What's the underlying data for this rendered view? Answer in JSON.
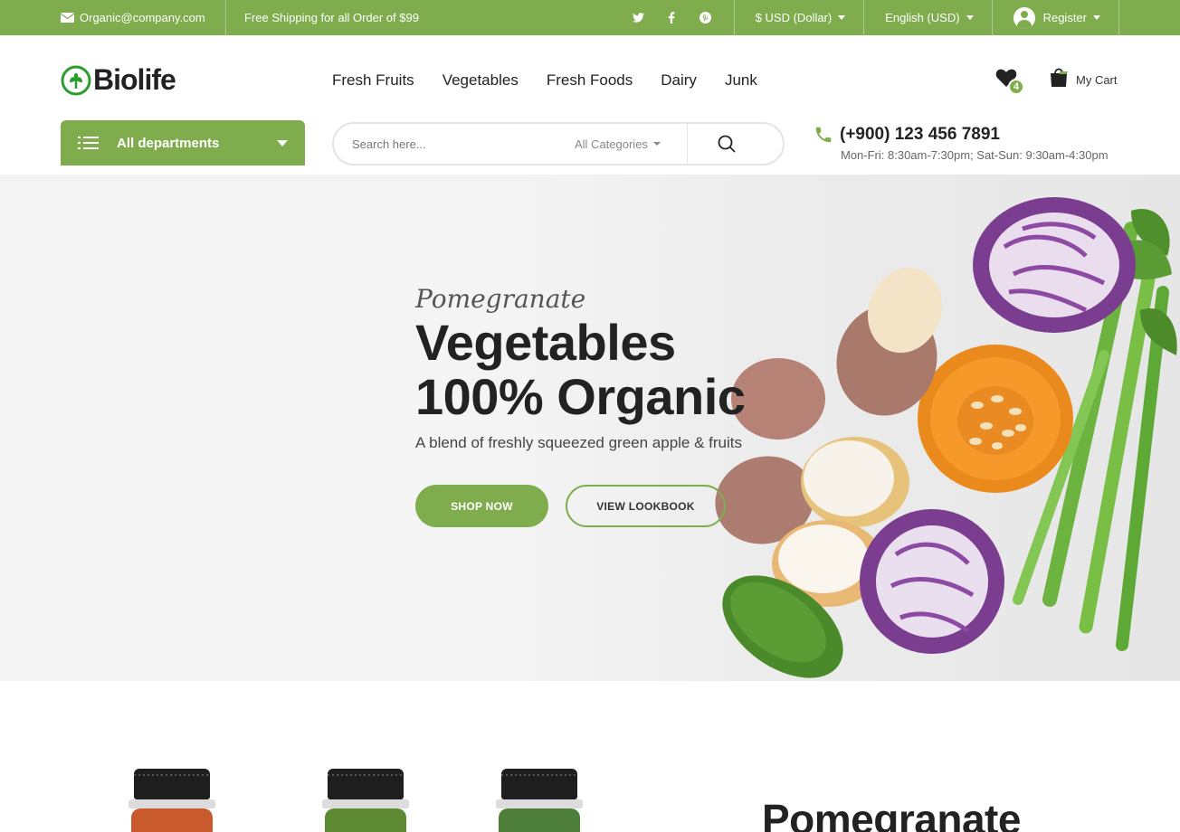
{
  "topbar": {
    "email": "Organic@company.com",
    "shipping": "Free Shipping for all Order of $99",
    "social": [
      "twitter-icon",
      "facebook-icon",
      "pinterest-icon"
    ],
    "currency": "$ USD (Dollar)",
    "language": "English (USD)",
    "register": "Register"
  },
  "header": {
    "logo": "Biolife",
    "nav": [
      "Fresh Fruits",
      "Vegetables",
      "Fresh Foods",
      "Dairy",
      "Junk"
    ],
    "wishlist_count": "4",
    "cart_label": "My Cart"
  },
  "search": {
    "departments_label": "All departments",
    "placeholder": "Search here...",
    "category": "All Categories"
  },
  "contact": {
    "phone": "(+900) 123 456 7891",
    "hours": "Mon-Fri: 8:30am-7:30pm; Sat-Sun: 9:30am-4:30pm"
  },
  "hero": {
    "subtitle": "Pomegranate",
    "title_line1": "Vegetables",
    "title_line2": "100% Organic",
    "description": "A blend of freshly squeezed green apple & fruits",
    "shop_button": "SHOP NOW",
    "lookbook_button": "VIEW LOOKBOOK"
  },
  "promo": {
    "title": "Pomegranate"
  },
  "colors": {
    "brand": "#7fad4e"
  }
}
